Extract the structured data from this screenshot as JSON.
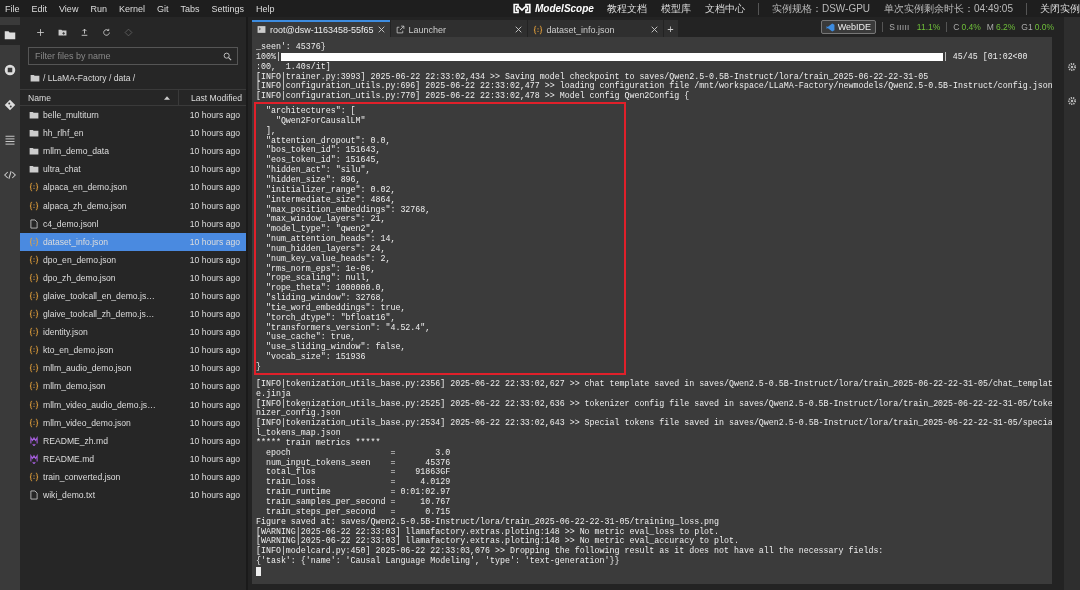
{
  "menu_bar": {
    "items": [
      "File",
      "Edit",
      "View",
      "Run",
      "Kernel",
      "Git",
      "Tabs",
      "Settings",
      "Help"
    ],
    "brand": "ModelScope",
    "links": [
      "教程文档",
      "模型库",
      "文档中心"
    ],
    "instance_spec": "实例规格：DSW-GPU",
    "remaining_time": "单次实例剩余时长：04:49:05",
    "close_button": "关闭实例"
  },
  "activity_bar": {
    "items": [
      {
        "kind": "folder",
        "selected": true
      },
      {
        "kind": "running",
        "selected": false
      },
      {
        "kind": "git",
        "selected": false
      },
      {
        "kind": "toc",
        "selected": false
      },
      {
        "kind": "code",
        "selected": false
      }
    ]
  },
  "file_browser": {
    "toolbar": [
      {
        "kind": "new",
        "disabled": false
      },
      {
        "kind": "new-folder",
        "disabled": false
      },
      {
        "kind": "upload",
        "disabled": false
      },
      {
        "kind": "refresh",
        "disabled": false
      },
      {
        "kind": "git-clone",
        "disabled": true
      }
    ],
    "filter_placeholder": "Filter files by name",
    "breadcrumb": "/ LLaMA-Factory / data /",
    "columns": [
      "Name",
      "Last Modified"
    ],
    "files": [
      {
        "name": "belle_multiturn",
        "kind": "folder",
        "modified": "10 hours ago",
        "selected": false
      },
      {
        "name": "hh_rlhf_en",
        "kind": "folder",
        "modified": "10 hours ago",
        "selected": false
      },
      {
        "name": "mllm_demo_data",
        "kind": "folder",
        "modified": "10 hours ago",
        "selected": false
      },
      {
        "name": "ultra_chat",
        "kind": "folder",
        "modified": "10 hours ago",
        "selected": false
      },
      {
        "name": "alpaca_en_demo.json",
        "kind": "json",
        "modified": "10 hours ago",
        "selected": false
      },
      {
        "name": "alpaca_zh_demo.json",
        "kind": "json",
        "modified": "10 hours ago",
        "selected": false
      },
      {
        "name": "c4_demo.jsonl",
        "kind": "file",
        "modified": "10 hours ago",
        "selected": false
      },
      {
        "name": "dataset_info.json",
        "kind": "json",
        "modified": "10 hours ago",
        "selected": true
      },
      {
        "name": "dpo_en_demo.json",
        "kind": "json",
        "modified": "10 hours ago",
        "selected": false
      },
      {
        "name": "dpo_zh_demo.json",
        "kind": "json",
        "modified": "10 hours ago",
        "selected": false
      },
      {
        "name": "glaive_toolcall_en_demo.js…",
        "kind": "json",
        "modified": "10 hours ago",
        "selected": false
      },
      {
        "name": "glaive_toolcall_zh_demo.js…",
        "kind": "json",
        "modified": "10 hours ago",
        "selected": false
      },
      {
        "name": "identity.json",
        "kind": "json",
        "modified": "10 hours ago",
        "selected": false
      },
      {
        "name": "kto_en_demo.json",
        "kind": "json",
        "modified": "10 hours ago",
        "selected": false
      },
      {
        "name": "mllm_audio_demo.json",
        "kind": "json",
        "modified": "10 hours ago",
        "selected": false
      },
      {
        "name": "mllm_demo.json",
        "kind": "json",
        "modified": "10 hours ago",
        "selected": false
      },
      {
        "name": "mllm_video_audio_demo.js…",
        "kind": "json",
        "modified": "10 hours ago",
        "selected": false
      },
      {
        "name": "mllm_video_demo.json",
        "kind": "json",
        "modified": "10 hours ago",
        "selected": false
      },
      {
        "name": "README_zh.md",
        "kind": "markdown",
        "modified": "10 hours ago",
        "selected": false
      },
      {
        "name": "README.md",
        "kind": "markdown",
        "modified": "10 hours ago",
        "selected": false
      },
      {
        "name": "train_converted.json",
        "kind": "json",
        "modified": "10 hours ago",
        "selected": false
      },
      {
        "name": "wiki_demo.txt",
        "kind": "file",
        "modified": "10 hours ago",
        "selected": false
      }
    ]
  },
  "tabs": [
    {
      "label": "root@dsw-1163458-55f65",
      "kind": "terminal",
      "selected": true
    },
    {
      "label": "Launcher",
      "kind": "launcher",
      "selected": false
    },
    {
      "label": "dataset_info.json",
      "kind": "json",
      "selected": false
    }
  ],
  "new_tab": "+",
  "status": {
    "webide": "WebIDE",
    "stats": [
      {
        "label": "S",
        "value": "11.1%",
        "kind": "meter"
      },
      {
        "label": "C",
        "value": "0.4%",
        "kind": "plain"
      },
      {
        "label": "M",
        "value": "6.2%",
        "kind": "plain"
      },
      {
        "label": "G1",
        "value": "0.0%",
        "kind": "plain"
      }
    ]
  },
  "terminal": {
    "cursor": true,
    "blocks": [
      {
        "kind": "plain",
        "lines": [
          {
            "kind": "text",
            "text": "_seen': 45376}"
          },
          {
            "kind": "progress",
            "prefix": "100%|",
            "level": 1,
            "suffix": "| 45/45 [01:02<00"
          },
          {
            "kind": "text",
            "text": ":00,  1.40s/it]"
          },
          {
            "kind": "text",
            "text": "[INFO|trainer.py:3993] 2025-06-22 22:33:02,434 >> Saving model checkpoint to saves/Qwen2.5-0.5B-Instruct/lora/train_2025-06-22-22-31-05"
          },
          {
            "kind": "text",
            "text": "[INFO|configuration_utils.py:696] 2025-06-22 22:33:02,477 >> loading configuration file /mnt/workspace/LLaMA-Factory/newmodels/Qwen2.5-0.5B-Instruct/config.json"
          },
          {
            "kind": "text",
            "text": "[INFO|configuration_utils.py:770] 2025-06-22 22:33:02,478 >> Model config Qwen2Config {"
          }
        ]
      },
      {
        "kind": "boxed",
        "lines": [
          {
            "kind": "text",
            "text": "  \"architectures\": ["
          },
          {
            "kind": "text",
            "text": "    \"Qwen2ForCausalLM\""
          },
          {
            "kind": "text",
            "text": "  ],"
          },
          {
            "kind": "text",
            "text": "  \"attention_dropout\": 0.0,"
          },
          {
            "kind": "text",
            "text": "  \"bos_token_id\": 151643,"
          },
          {
            "kind": "text",
            "text": "  \"eos_token_id\": 151645,"
          },
          {
            "kind": "text",
            "text": "  \"hidden_act\": \"silu\","
          },
          {
            "kind": "text",
            "text": "  \"hidden_size\": 896,"
          },
          {
            "kind": "text",
            "text": "  \"initializer_range\": 0.02,"
          },
          {
            "kind": "text",
            "text": "  \"intermediate_size\": 4864,"
          },
          {
            "kind": "text",
            "text": "  \"max_position_embeddings\": 32768,"
          },
          {
            "kind": "text",
            "text": "  \"max_window_layers\": 21,"
          },
          {
            "kind": "text",
            "text": "  \"model_type\": \"qwen2\","
          },
          {
            "kind": "text",
            "text": "  \"num_attention_heads\": 14,"
          },
          {
            "kind": "text",
            "text": "  \"num_hidden_layers\": 24,"
          },
          {
            "kind": "text",
            "text": "  \"num_key_value_heads\": 2,"
          },
          {
            "kind": "text",
            "text": "  \"rms_norm_eps\": 1e-06,"
          },
          {
            "kind": "text",
            "text": "  \"rope_scaling\": null,"
          },
          {
            "kind": "text",
            "text": "  \"rope_theta\": 1000000.0,"
          },
          {
            "kind": "text",
            "text": "  \"sliding_window\": 32768,"
          },
          {
            "kind": "text",
            "text": "  \"tie_word_embeddings\": true,"
          },
          {
            "kind": "text",
            "text": "  \"torch_dtype\": \"bfloat16\","
          },
          {
            "kind": "text",
            "text": "  \"transformers_version\": \"4.52.4\","
          },
          {
            "kind": "text",
            "text": "  \"use_cache\": true,"
          },
          {
            "kind": "text",
            "text": "  \"use_sliding_window\": false,"
          },
          {
            "kind": "text",
            "text": "  \"vocab_size\": 151936"
          },
          {
            "kind": "text",
            "text": "}"
          }
        ]
      },
      {
        "kind": "plain",
        "lines": [
          {
            "kind": "text",
            "text": "[INFO|tokenization_utils_base.py:2356] 2025-06-22 22:33:02,627 >> chat template saved in saves/Qwen2.5-0.5B-Instruct/lora/train_2025-06-22-22-31-05/chat_templat"
          },
          {
            "kind": "text",
            "text": "e.jinja"
          },
          {
            "kind": "text",
            "text": "[INFO|tokenization_utils_base.py:2525] 2025-06-22 22:33:02,636 >> tokenizer config file saved in saves/Qwen2.5-0.5B-Instruct/lora/train_2025-06-22-22-31-05/toke"
          },
          {
            "kind": "text",
            "text": "nizer_config.json"
          },
          {
            "kind": "text",
            "text": "[INFO|tokenization_utils_base.py:2534] 2025-06-22 22:33:02,643 >> Special tokens file saved in saves/Qwen2.5-0.5B-Instruct/lora/train_2025-06-22-22-31-05/specia"
          },
          {
            "kind": "text",
            "text": "l_tokens_map.json"
          },
          {
            "kind": "text",
            "text": "***** train metrics *****"
          },
          {
            "kind": "text",
            "text": "  epoch                    =        3.0"
          },
          {
            "kind": "text",
            "text": "  num_input_tokens_seen    =      45376"
          },
          {
            "kind": "text",
            "text": "  total_flos               =    91863GF"
          },
          {
            "kind": "text",
            "text": "  train_loss               =     4.0129"
          },
          {
            "kind": "text",
            "text": "  train_runtime            = 0:01:02.97"
          },
          {
            "kind": "text",
            "text": "  train_samples_per_second =     10.767"
          },
          {
            "kind": "text",
            "text": "  train_steps_per_second   =      0.715"
          },
          {
            "kind": "text",
            "text": "Figure saved at: saves/Qwen2.5-0.5B-Instruct/lora/train_2025-06-22-22-31-05/training_loss.png"
          },
          {
            "kind": "text",
            "text": "[WARNING|2025-06-22 22:33:03] llamafactory.extras.ploting:148 >> No metric eval_loss to plot."
          },
          {
            "kind": "text",
            "text": "[WARNING|2025-06-22 22:33:03] llamafactory.extras.ploting:148 >> No metric eval_accuracy to plot."
          },
          {
            "kind": "text",
            "text": "[INFO|modelcard.py:450] 2025-06-22 22:33:03,076 >> Dropping the following result as it does not have all the necessary fields:"
          },
          {
            "kind": "text",
            "text": "{'task': {'name': 'Causal Language Modeling', 'type': 'text-generation'}}"
          }
        ]
      }
    ]
  }
}
